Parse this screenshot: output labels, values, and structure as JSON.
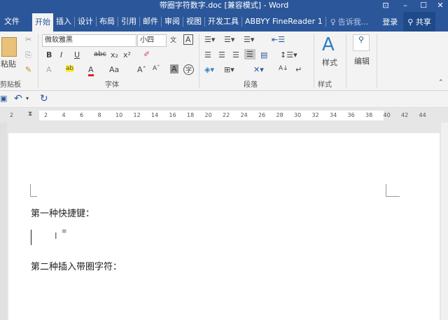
{
  "window": {
    "title": "带圈字符数字.doc [兼容模式] - Word",
    "buttons": [
      "⊡",
      "–",
      "☐",
      "✕"
    ]
  },
  "tabs": [
    "文件",
    "开始",
    "插入",
    "设计",
    "布局",
    "引用",
    "邮件",
    "审阅",
    "视图",
    "开发工具",
    "ABBYY FineReader 1"
  ],
  "tell_me": "告诉我...",
  "login": "登录",
  "share": "共享",
  "ribbon": {
    "paste": "粘贴",
    "font_name": "微软雅黑",
    "font_size": "小四",
    "styles": "样式",
    "edit": "编辑",
    "groups": {
      "clipboard": "剪贴板",
      "font": "字体",
      "paragraph": "段落",
      "styles": "样式"
    }
  },
  "ruler": [
    "2",
    "2",
    "4",
    "6",
    "8",
    "10",
    "12",
    "14",
    "16",
    "18",
    "20",
    "22",
    "24",
    "26",
    "28",
    "30",
    "32",
    "34",
    "36",
    "38",
    "40",
    "42",
    "44"
  ],
  "doc": {
    "line1": "第一种快捷键：",
    "line2": "第二种插入带圈字符："
  }
}
